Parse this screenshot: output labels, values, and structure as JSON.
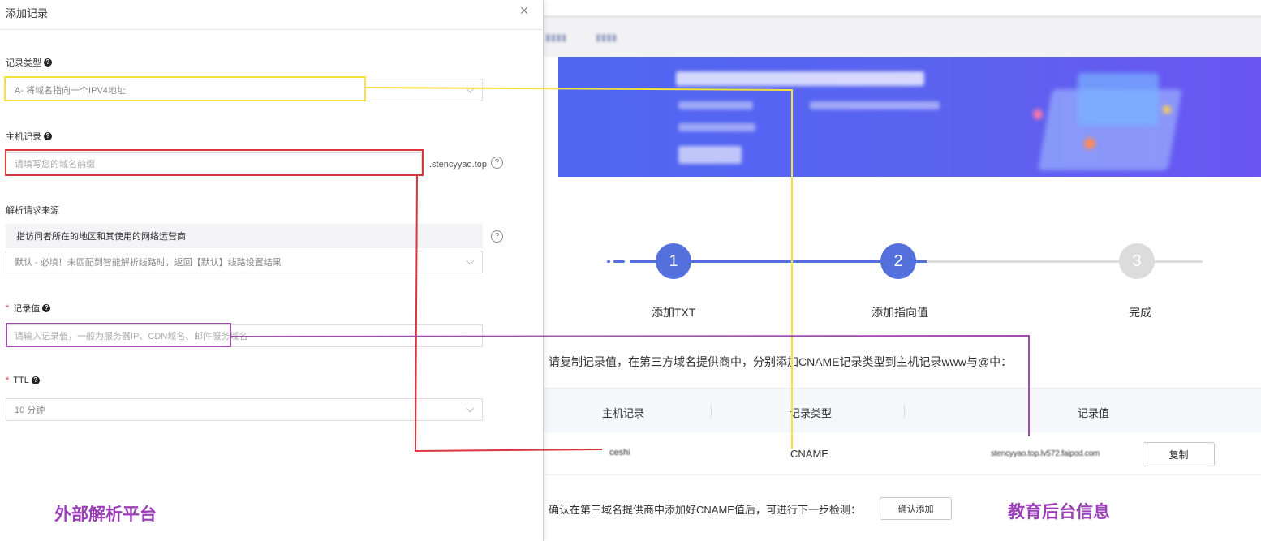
{
  "colors": {
    "accent": "#5470dc",
    "inactive": "#dcdcdc",
    "highlight_yellow": "#f5e23a",
    "highlight_red": "#d9363e",
    "highlight_purple": "#a34bb0",
    "annotation_text": "#9b3fb8"
  },
  "drawer": {
    "title": "添加记录",
    "close_icon": "close-icon",
    "fields": {
      "record_type": {
        "label": "记录类型",
        "value": "A- 将域名指向一个IPV4地址"
      },
      "host_record": {
        "label": "主机记录",
        "placeholder": "请填写您的域名前缀",
        "suffix": ".stencyyao.top"
      },
      "resolve_source": {
        "label": "解析请求来源",
        "hint": "指访问者所在的地区和其使用的网络运营商",
        "value": "默认 - 必填！未匹配到智能解析线路时，返回【默认】线路设置结果"
      },
      "record_value": {
        "label": "记录值",
        "placeholder": "请输入记录值，一般为服务器IP、CDN域名、邮件服务域名"
      },
      "ttl": {
        "label": "TTL",
        "value": "10 分钟"
      }
    }
  },
  "background_page": {
    "steps": [
      {
        "number": "1",
        "label": "添加TXT",
        "state": "done"
      },
      {
        "number": "2",
        "label": "添加指向值",
        "state": "active"
      },
      {
        "number": "3",
        "label": "完成",
        "state": "pending"
      }
    ],
    "progress_fraction": 0.52,
    "instruction": "请复制记录值，在第三方域名提供商中，分别添加CNAME记录类型到主机记录www与@中：",
    "table": {
      "headers": [
        "主机记录",
        "记录类型",
        "记录值"
      ],
      "row": {
        "host": "ceshi",
        "type": "CNAME",
        "value": "stencyyao.top.lv572.faipod.com",
        "copy_label": "复制"
      }
    },
    "confirm_text": "确认在第三域名提供商中添加好CNAME值后，可进行下一步检测：",
    "confirm_button": "确认添加"
  },
  "annotations": {
    "left_label": "外部解析平台",
    "right_label": "教育后台信息"
  }
}
